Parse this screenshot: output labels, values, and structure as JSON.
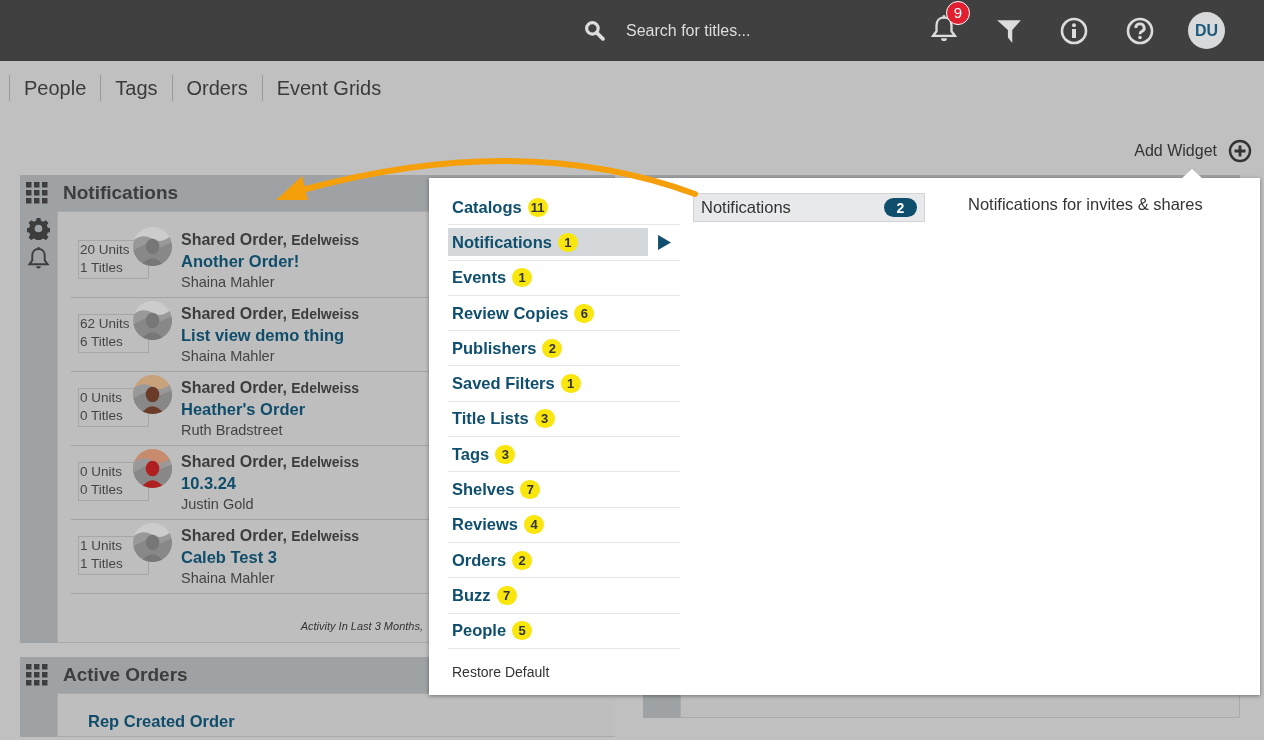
{
  "topbar": {
    "search": {
      "placeholder": "Search for titles..."
    },
    "notification_count": "9",
    "avatar": "DU"
  },
  "nav": [
    {
      "label": "People"
    },
    {
      "label": "Tags"
    },
    {
      "label": "Orders"
    },
    {
      "label": "Event Grids"
    }
  ],
  "add_widget": "Add Widget",
  "widgets": [
    {
      "title": "Notifications",
      "items": [
        {
          "type": "Shared Order,",
          "source": "Edelweiss",
          "name": "Another Order!",
          "person": "Shaina Mahler",
          "units": "20 Units",
          "titles": "1 Titles"
        },
        {
          "type": "Shared Order,",
          "source": "Edelweiss",
          "name": "List view demo thing",
          "person": "Shaina Mahler",
          "units": "62 Units",
          "titles": "6 Titles"
        },
        {
          "type": "Shared Order,",
          "source": "Edelweiss",
          "name": "Heather's Order",
          "person": "Ruth Bradstreet",
          "units": "0 Units",
          "titles": "0 Titles"
        },
        {
          "type": "Shared Order,",
          "source": "Edelweiss",
          "name": "10.3.24",
          "person": "Justin Gold",
          "units": "0 Units",
          "titles": "0 Titles"
        },
        {
          "type": "Shared Order,",
          "source": "Edelweiss",
          "name": "Caleb Test 3",
          "person": "Shaina Mahler",
          "units": "1 Units",
          "titles": "1 Titles"
        }
      ],
      "footer": "Activity In Last 3 Months,"
    },
    {
      "title": "Active Orders",
      "items": [
        {
          "name": "Rep Created Order"
        }
      ]
    }
  ],
  "menu": {
    "categories": [
      {
        "label": "Catalogs",
        "count": "11",
        "selected": false
      },
      {
        "label": "Notifications",
        "count": "1",
        "selected": true
      },
      {
        "label": "Events",
        "count": "1",
        "selected": false
      },
      {
        "label": "Review Copies",
        "count": "6",
        "selected": false
      },
      {
        "label": "Publishers",
        "count": "2",
        "selected": false
      },
      {
        "label": "Saved Filters",
        "count": "1",
        "selected": false
      },
      {
        "label": "Title Lists",
        "count": "3",
        "selected": false
      },
      {
        "label": "Tags",
        "count": "3",
        "selected": false
      },
      {
        "label": "Shelves",
        "count": "7",
        "selected": false
      },
      {
        "label": "Reviews",
        "count": "4",
        "selected": false
      },
      {
        "label": "Orders",
        "count": "2",
        "selected": false
      },
      {
        "label": "Buzz",
        "count": "7",
        "selected": false
      },
      {
        "label": "People",
        "count": "5",
        "selected": false
      }
    ],
    "submenu": [
      {
        "label": "Notifications",
        "count": "2",
        "description": "Notifications for invites & shares"
      }
    ],
    "restore": "Restore Default"
  }
}
